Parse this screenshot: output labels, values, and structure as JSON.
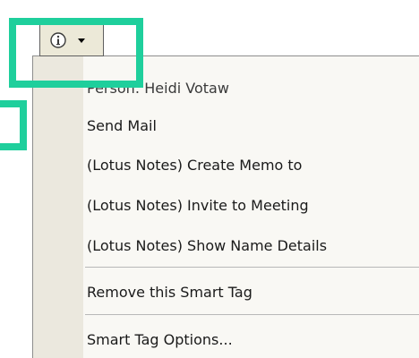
{
  "smart_tag": {
    "icon": "info-icon",
    "dropdown_icon": "caret-down-icon"
  },
  "menu": {
    "header": "Person: Heidi Votaw",
    "items": [
      "Send Mail",
      "(Lotus Notes) Create Memo to",
      "(Lotus Notes) Invite to Meeting",
      "(Lotus Notes) Show Name Details"
    ],
    "remove": "Remove this Smart Tag",
    "options": "Smart Tag Options..."
  },
  "colors": {
    "highlight": "#1fcf9c",
    "menu_background": "#f9f8f4",
    "gutter": "#ebe8de"
  }
}
